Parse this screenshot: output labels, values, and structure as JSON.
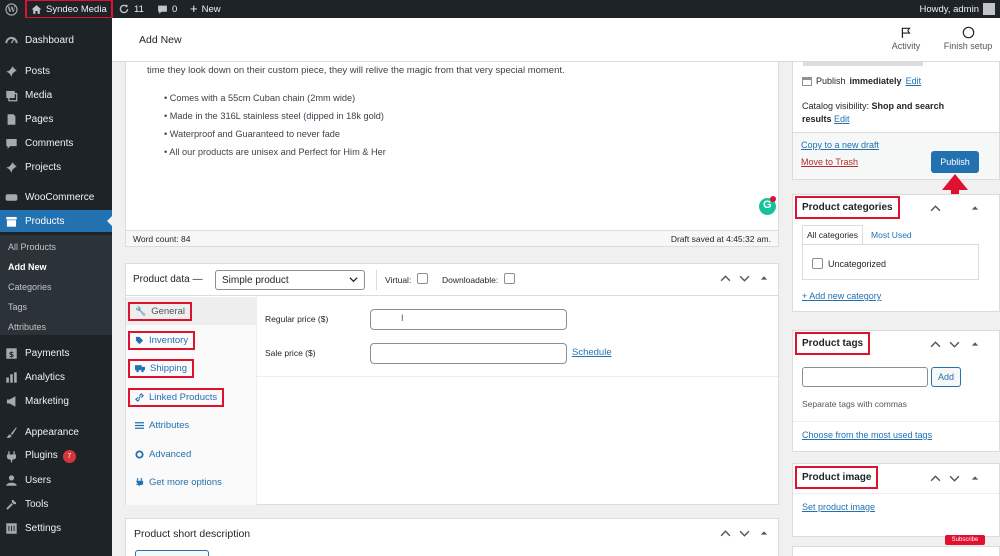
{
  "adminbar": {
    "site_name": "Syndeo Media",
    "updates_count": "11",
    "comments_count": "0",
    "new_label": "New",
    "howdy": "Howdy, admin"
  },
  "menu": {
    "dashboard": "Dashboard",
    "posts": "Posts",
    "media": "Media",
    "pages": "Pages",
    "comments": "Comments",
    "projects": "Projects",
    "woocommerce": "WooCommerce",
    "products": "Products",
    "sub_all": "All Products",
    "sub_add": "Add New",
    "sub_categories": "Categories",
    "sub_tags": "Tags",
    "sub_attributes": "Attributes",
    "payments": "Payments",
    "analytics": "Analytics",
    "marketing": "Marketing",
    "appearance": "Appearance",
    "plugins": "Plugins",
    "plugins_badge": "7",
    "users": "Users",
    "tools": "Tools",
    "settings": "Settings"
  },
  "header": {
    "title": "Add New",
    "activity": "Activity",
    "finish_setup": "Finish setup"
  },
  "editor": {
    "intro": "time they look down on their custom piece, they will relive the magic from that very special moment.",
    "bullets": [
      "Comes with a 55cm Cuban chain (2mm wide)",
      "Made in the 316L stainless steel (dipped in 18k gold)",
      "Waterproof and Guaranteed to never fade",
      "All our products are unisex and Perfect for Him & Her"
    ],
    "word_count": "Word count: 84",
    "draft_saved": "Draft saved at 4:45:32 am."
  },
  "product_data": {
    "title": "Product data —",
    "type_value": "Simple product",
    "virtual": "Virtual:",
    "downloadable": "Downloadable:",
    "tabs": [
      "General",
      "Inventory",
      "Shipping",
      "Linked Products",
      "Attributes",
      "Advanced",
      "Get more options"
    ],
    "regular_price_label": "Regular price ($)",
    "sale_price_label": "Sale price ($)",
    "schedule": "Schedule"
  },
  "short_description": {
    "title": "Product short description"
  },
  "publish": {
    "publish_label": "Publish",
    "publish_when": "immediately",
    "edit": "Edit",
    "catalog_label": "Catalog visibility:",
    "catalog_value": "Shop and search",
    "catalog_value2": "results",
    "copy_draft": "Copy to a new draft",
    "move_trash": "Move to Trash",
    "publish_button": "Publish"
  },
  "categories": {
    "title": "Product categories",
    "tab_all": "All categories",
    "tab_most": "Most Used",
    "item": "Uncategorized",
    "add_new": "+ Add new category"
  },
  "tags": {
    "title": "Product tags",
    "add_button": "Add",
    "hint": "Separate tags with commas",
    "choose": "Choose from the most used tags"
  },
  "image": {
    "title": "Product image",
    "set": "Set product image"
  },
  "watermark": {
    "subscribe": "Subscribe"
  },
  "colors": {
    "accent": "#2271b1",
    "highlight": "#e0102f",
    "admin_dark": "#1d2327"
  }
}
